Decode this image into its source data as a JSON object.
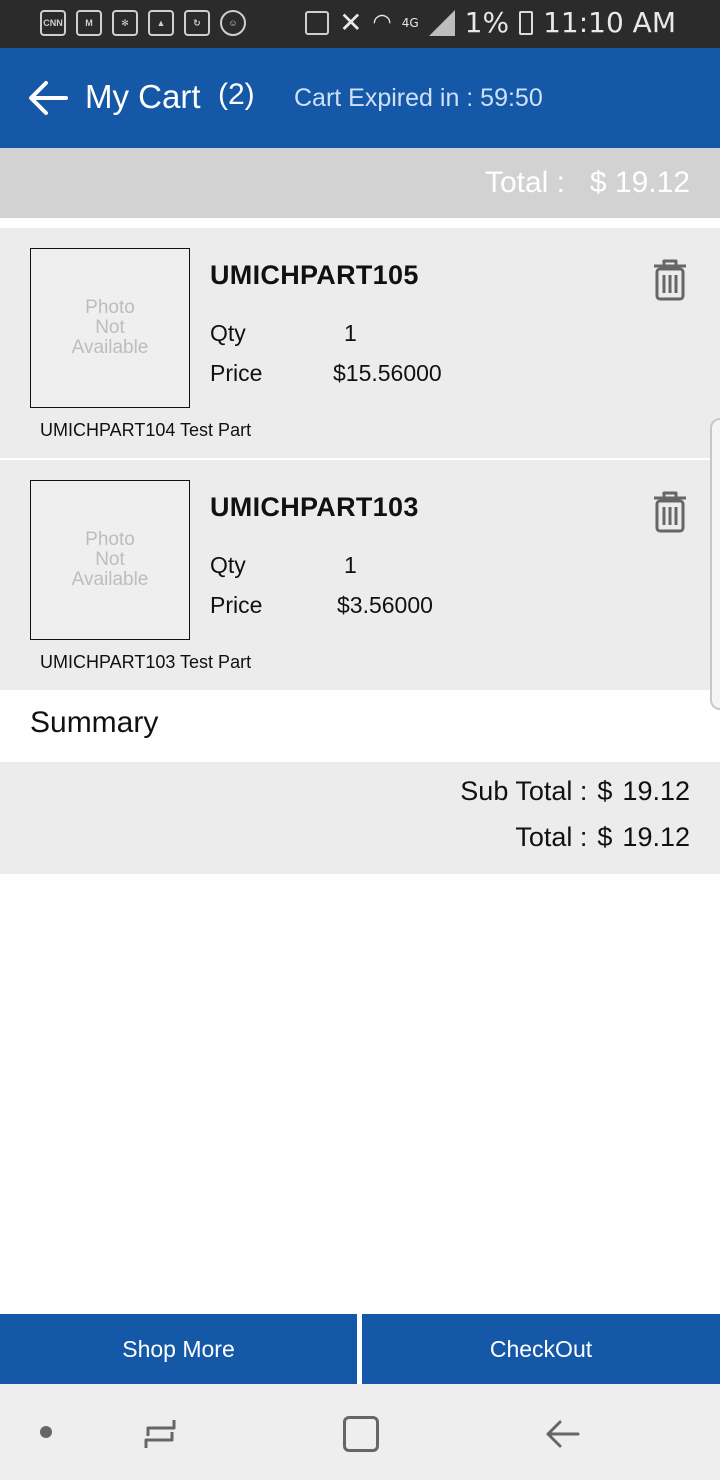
{
  "status_bar": {
    "time": "11:10 AM",
    "battery": "1%",
    "network": "4G",
    "left_icons": [
      "cnn-icon",
      "gmail-icon",
      "cnbc-icon",
      "gallery-icon",
      "update-icon",
      "account-icon"
    ],
    "right_icons": [
      "nfc-icon",
      "mute-icon",
      "wifi-icon",
      "signal-icon",
      "battery-icon"
    ]
  },
  "header": {
    "title": "My Cart",
    "count": "(2)",
    "expiry": "Cart Expired in : 59:50",
    "back_icon": "arrow-left-icon"
  },
  "total_bar": {
    "label": "Total :",
    "value": "$ 19.12"
  },
  "items": [
    {
      "part_number": "UMICHPART105",
      "photo_line1": "Photo",
      "photo_line2": "Not",
      "photo_line3": "Available",
      "qty_label": "Qty",
      "qty": "1",
      "price_label": "Price",
      "price": "$15.56000",
      "description": "UMICHPART104 Test Part"
    },
    {
      "part_number": "UMICHPART103",
      "photo_line1": "Photo",
      "photo_line2": "Not",
      "photo_line3": "Available",
      "qty_label": "Qty",
      "qty": "1",
      "price_label": "Price",
      "price": "$3.56000",
      "description": "UMICHPART103 Test Part"
    }
  ],
  "summary": {
    "title": "Summary",
    "subtotal_label": "Sub Total :",
    "subtotal_currency": "$",
    "subtotal_value": "19.12",
    "total_label": "Total :",
    "total_currency": "$",
    "total_value": "19.12"
  },
  "buttons": {
    "shop_more": "Shop More",
    "checkout": "CheckOut"
  },
  "colors": {
    "primary": "#1558a8",
    "total_bar": "#d2d2d2",
    "item_background": "#ececec"
  }
}
